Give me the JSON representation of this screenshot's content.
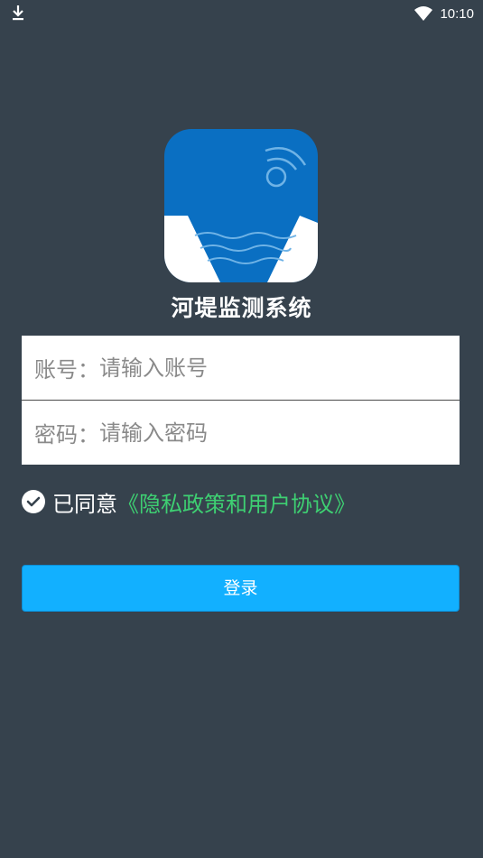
{
  "status_bar": {
    "time": "10:10",
    "icons": [
      "download-icon",
      "wifi-icon"
    ]
  },
  "app": {
    "title": "河堤监测系统",
    "logo_icon": "river-dam-wifi-logo"
  },
  "form": {
    "account_label": "账号：",
    "account_placeholder": "请输入账号",
    "account_value": "",
    "password_label": "密码：",
    "password_placeholder": "请输入密码",
    "password_value": ""
  },
  "agreement": {
    "checked": true,
    "prefix": "已同意",
    "link_text": "《隐私政策和用户协议》"
  },
  "login": {
    "label": "登录"
  },
  "colors": {
    "background": "#36424d",
    "logo_blue": "#0a6fc2",
    "button_blue": "#12b0ff",
    "link_green": "#3ecf72"
  }
}
